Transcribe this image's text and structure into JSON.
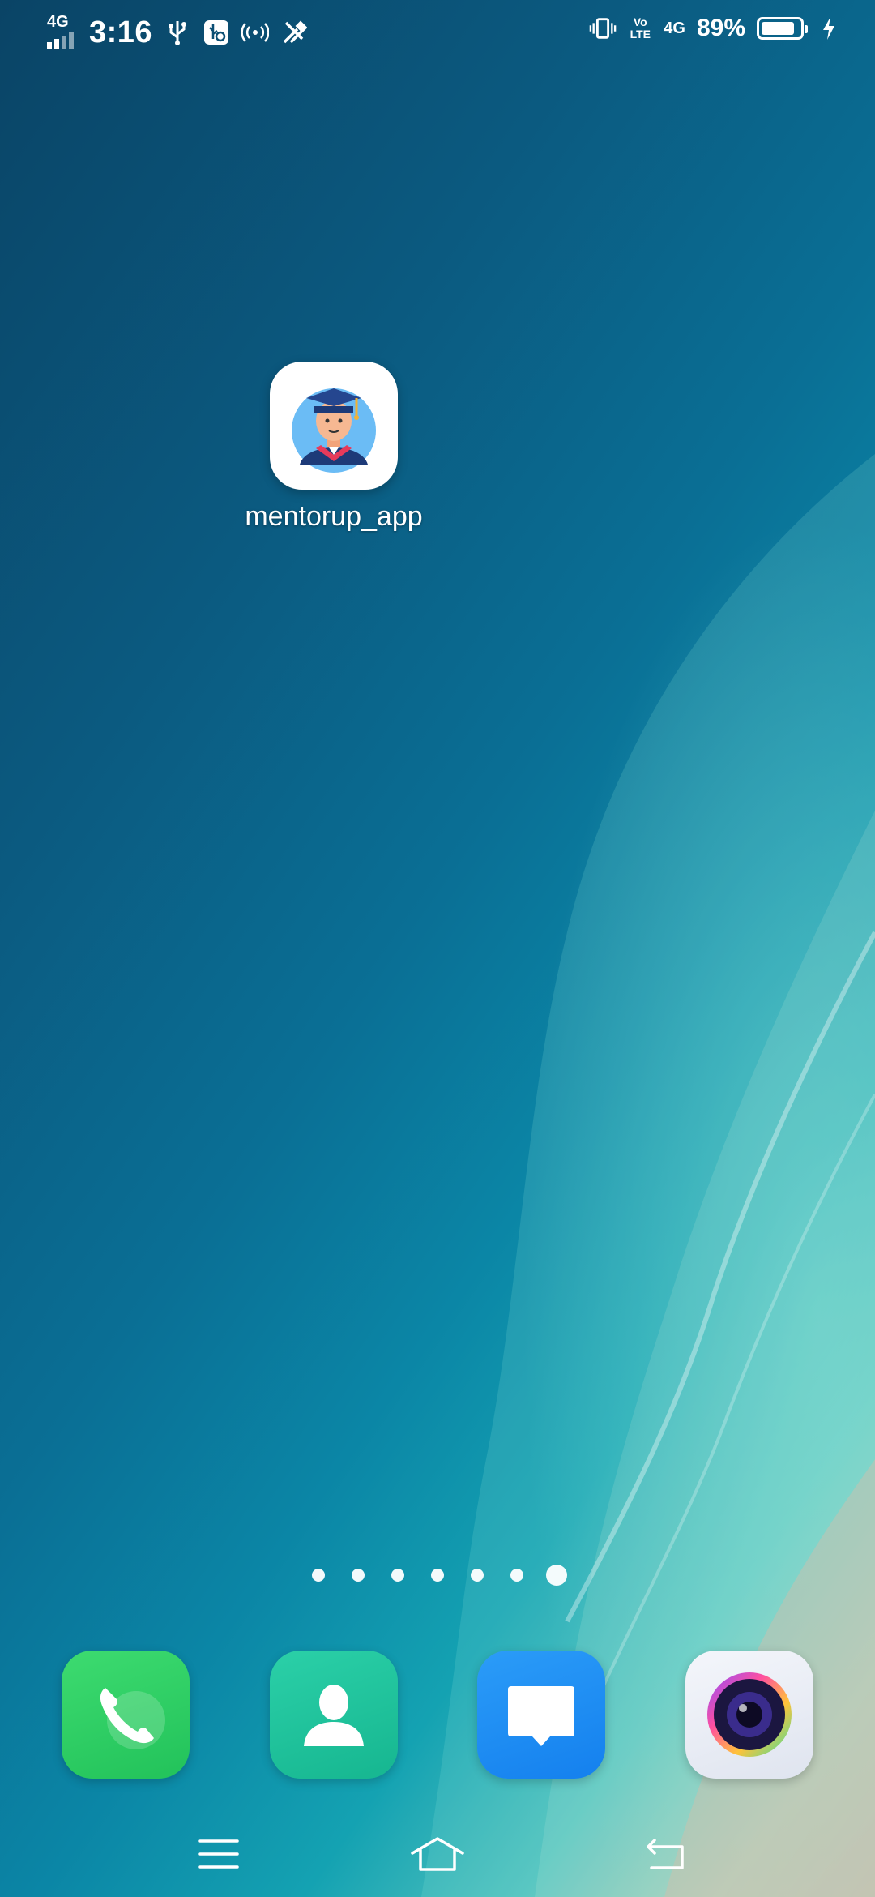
{
  "status_bar": {
    "network_left": "4G",
    "time": "3:16",
    "network_right": "4G",
    "volte_label": "Vo LTE",
    "battery_percent": "89%",
    "battery_level": 0.89
  },
  "home": {
    "apps": [
      {
        "label": "mentorup_app",
        "icon": "graduate-avatar-icon"
      }
    ]
  },
  "page_indicator": {
    "count": 7,
    "active_index": 6
  },
  "dock": {
    "items": [
      {
        "icon": "phone-icon",
        "color": "#2fcf63"
      },
      {
        "icon": "contacts-icon",
        "color": "#20c5a0"
      },
      {
        "icon": "messages-icon",
        "color": "#1e8ff5"
      },
      {
        "icon": "camera-icon",
        "color": "#e8ecf5"
      }
    ]
  },
  "nav_bar": {
    "buttons": [
      "menu-icon",
      "home-icon",
      "back-icon"
    ]
  },
  "colors": {
    "status_text": "#ffffff",
    "wallpaper_deep": "#0a4466",
    "wallpaper_shallow": "#4fc1bd",
    "sand": "#c9b7a8"
  }
}
